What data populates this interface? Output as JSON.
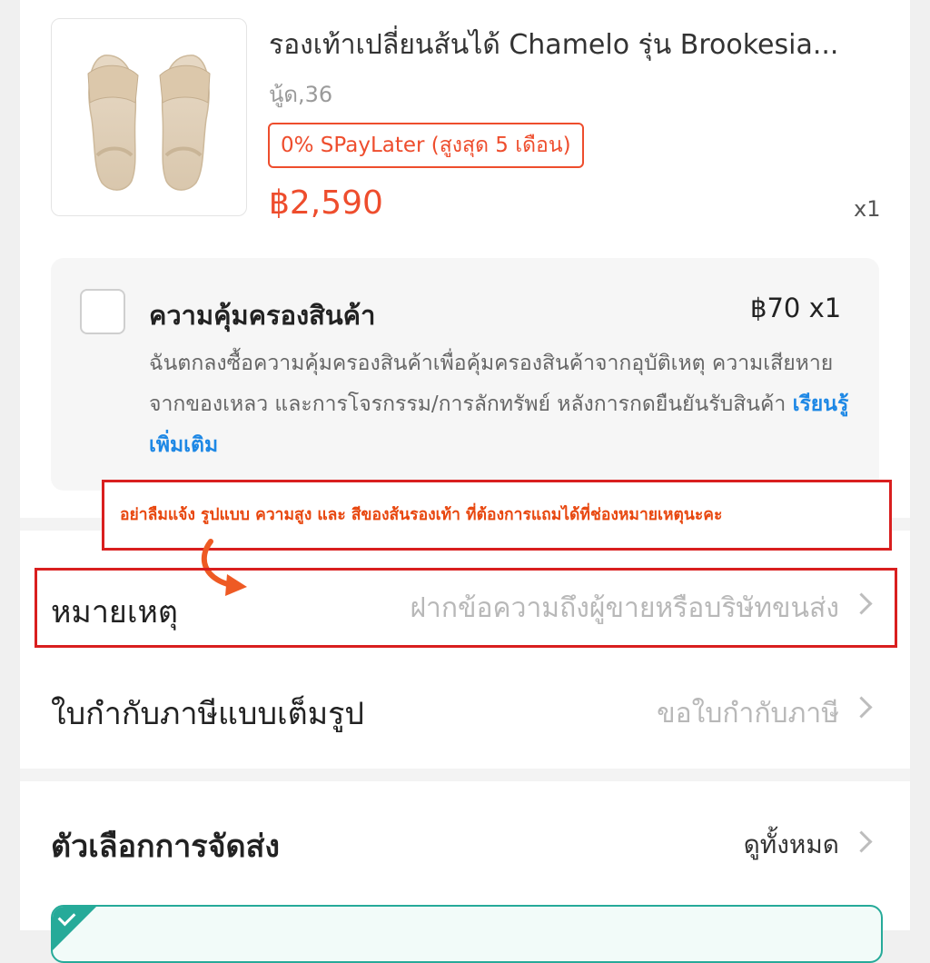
{
  "product": {
    "title": "รองเท้าเปลี่ยนส้นได้ Chamelo รุ่น Brookesia...",
    "variant": "นู้ด,36",
    "spaylater_badge": "0% SPayLater (สูงสุด 5 เดือน)",
    "price": "฿2,590",
    "quantity": "x1"
  },
  "protection": {
    "title": "ความคุ้มครองสินค้า",
    "price_qty": "฿70  x1",
    "description": "ฉันตกลงซื้อความคุ้มครองสินค้าเพื่อคุ้มครองสินค้าจากอุบัติเหตุ ความเสียหายจากของเหลว และการโจรกรรม/การลักทรัพย์ หลังการกดยืนยันรับสินค้า",
    "learn_more": "เรียนรู้เพิ่มเติม"
  },
  "annotation": {
    "text": "อย่าลืมแจ้ง รูปแบบ ความสูง และ สีของส้นรองเท้า ที่ต้องการแถมได้ที่ช่องหมายเหตุนะคะ",
    "highlight_color": "#d91f1f",
    "text_color": "#e8470f"
  },
  "note_row": {
    "label": "หมายเหตุ",
    "placeholder": "ฝากข้อความถึงผู้ขายหรือบริษัทขนส่ง"
  },
  "tax_invoice_row": {
    "label": "ใบกำกับภาษีแบบเต็มรูป",
    "value": "ขอใบกำกับภาษี"
  },
  "shipping": {
    "label": "ตัวเลือกการจัดส่ง",
    "view_all": "ดูทั้งหมด"
  },
  "colors": {
    "accent": "#ee4d2d",
    "link": "#1e88e5",
    "selected_green": "#26aa99"
  },
  "icons": [
    "sandal-product-image",
    "chevron-right-icon",
    "curved-arrow-icon",
    "check-icon"
  ]
}
